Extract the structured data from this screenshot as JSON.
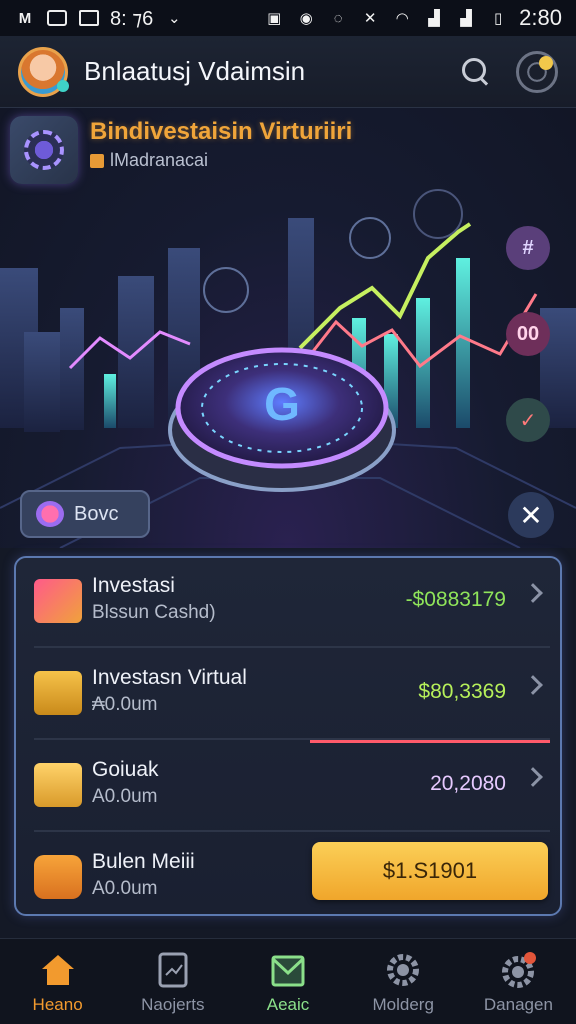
{
  "status_bar": {
    "time": "2:80",
    "left_glyph": "8: ⁊6"
  },
  "app_bar": {
    "title": "Bnlaatusj Vdaimsin"
  },
  "hero": {
    "title": "Bindivestaisin Virturiiri",
    "subtitle": "lMadranacai",
    "side_buttons": [
      "#",
      "00",
      "✓"
    ]
  },
  "save_button": {
    "label": "Bovc"
  },
  "list": [
    {
      "title": "Investasi",
      "sub": "Blssun Cashd)",
      "value": "-$0883179",
      "value_color": "#8fe45a",
      "icon": "cross-swords-icon"
    },
    {
      "title": "Investasn Virtual",
      "sub": "₳0.0um",
      "value": "$80,3369",
      "value_color": "#b6f05a",
      "icon": "wallet-icon"
    },
    {
      "title": "Goiuak",
      "sub": "A0.0um",
      "value": "20,2080",
      "value_color": "#e6c9ff",
      "icon": "gold-bars-icon"
    },
    {
      "title": "Bulen Meiii",
      "sub": "A0.0um",
      "value": "",
      "value_color": "#ffffff",
      "icon": "puzzle-icon"
    }
  ],
  "gold_button": {
    "label": "$1.S1901"
  },
  "bottom_nav": [
    {
      "label": "Heano",
      "icon": "home-icon"
    },
    {
      "label": "Naojerts",
      "icon": "tablet-icon"
    },
    {
      "label": "Aeaic",
      "icon": "mail-icon"
    },
    {
      "label": "Molderg",
      "icon": "gear-icon"
    },
    {
      "label": "Danagen",
      "icon": "settings-badge-icon"
    }
  ],
  "colors": {
    "accent": "#f29a2e",
    "panel_border": "#5c79b0",
    "gold": "#f0a62b"
  }
}
